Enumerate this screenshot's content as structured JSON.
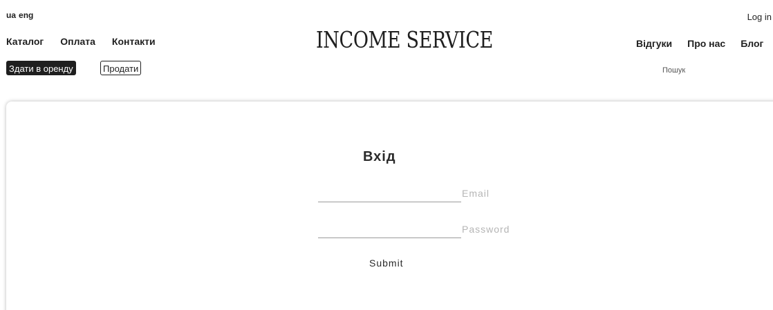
{
  "header": {
    "languages": [
      "ua",
      "eng"
    ],
    "login_label": "Log in",
    "brand": "INCOME SERVICE",
    "nav_left": [
      "Каталог",
      "Оплата",
      "Контакти"
    ],
    "nav_right": [
      "Відгуки",
      "Про нас",
      "Блог"
    ],
    "rent_button": "Здати в оренду",
    "sell_button": "Продати",
    "search_placeholder": "Пошук"
  },
  "login_form": {
    "title": "Вхід",
    "email_placeholder": "Email",
    "password_placeholder": "Password",
    "submit_label": "Submit"
  }
}
